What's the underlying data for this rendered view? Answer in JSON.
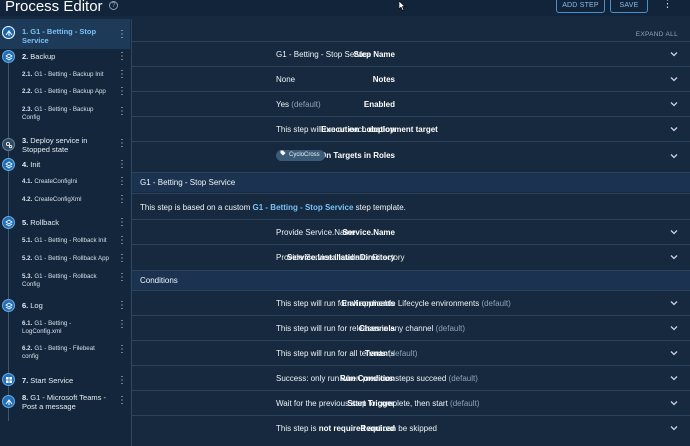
{
  "header": {
    "title": "Process Editor",
    "help_glyph": "?",
    "add_step_label": "ADD STEP",
    "save_label": "SAVE",
    "more_glyph": "⋮"
  },
  "sidebar": {
    "steps": [
      {
        "num": "1.",
        "label": "G1 - Betting - Stop Service",
        "icon": "deploy-icon",
        "selected": true
      },
      {
        "num": "2.",
        "label": "Backup",
        "icon": "layers-icon"
      },
      {
        "num": "2.1.",
        "label": "G1 - Betting - Backup Init",
        "child": true
      },
      {
        "num": "2.2.",
        "label": "G1 - Betting - Backup App",
        "child": true
      },
      {
        "num": "2.3.",
        "label": "G1 - Betting - Backup Config",
        "child": true
      },
      {
        "num": "3.",
        "label": "Deploy service in Stopped state",
        "icon": "gears-icon"
      },
      {
        "num": "4.",
        "label": "Init",
        "icon": "layers-icon"
      },
      {
        "num": "4.1.",
        "label": "CreateConfigIni",
        "child": true
      },
      {
        "num": "4.2.",
        "label": "CreateConfigXml",
        "child": true
      },
      {
        "num": "5.",
        "label": "Rollback",
        "icon": "layers-icon"
      },
      {
        "num": "5.1.",
        "label": "G1 - Betting - Rollback Init",
        "child": true
      },
      {
        "num": "5.2.",
        "label": "G1 - Betting - Rollback App",
        "child": true
      },
      {
        "num": "5.3.",
        "label": "G1 - Betting - Rollback Config",
        "child": true
      },
      {
        "num": "6.",
        "label": "Log",
        "icon": "layers-icon"
      },
      {
        "num": "6.1.",
        "label": "G1 - Betting - LogConfig.xml",
        "child": true
      },
      {
        "num": "6.2.",
        "label": "G1 - Betting - Filebeat config",
        "child": true
      },
      {
        "num": "7.",
        "label": "Start Service",
        "icon": "windows-icon"
      },
      {
        "num": "8.",
        "label": "G1 - Microsoft Teams - Post a message",
        "icon": "deploy-icon"
      }
    ]
  },
  "main": {
    "expand_all": "EXPAND ALL",
    "step_name_label": "Step Name",
    "step_name_value": "G1 - Betting - Stop Service",
    "notes_label": "Notes",
    "notes_value": "None",
    "enabled_label": "Enabled",
    "enabled_value": "Yes",
    "enabled_default": "(default)",
    "exec_label": "Execution Location",
    "exec_value_pre": "This step will run on each",
    "exec_value_bold": "deployment target",
    "roles_label": "On Targets in Roles",
    "roles_tag": "CycloCross",
    "section_template_title": "G1 - Betting - Stop Service",
    "template_info_pre": "This step is based on a custom",
    "template_info_link": "G1 - Betting - Stop Service",
    "template_info_post": "step template.",
    "svc_name_label": "Service.Name",
    "svc_name_placeholder": "Provide Service.Name",
    "svc_dir_label": "Service.InstallationDirectory",
    "svc_dir_placeholder": "Provide Service.InstallationDirectory",
    "conditions_title": "Conditions",
    "conditions": [
      {
        "label": "Environments",
        "value": "This step will run for all applicable Lifecycle environments",
        "suffix": "(default)"
      },
      {
        "label": "Channels",
        "value": "This step will run for releases in any channel",
        "suffix": "(default)"
      },
      {
        "label": "Tenants",
        "value": "This step will run for all tenants",
        "suffix": "(default)"
      },
      {
        "label": "Run Condition",
        "value": "Success: only run when previous steps succeed",
        "suffix": "(default)"
      },
      {
        "label": "Start Trigger",
        "value": "Wait for the previous step to complete, then start",
        "suffix": "(default)"
      }
    ],
    "required_label": "Required",
    "required_pre": "This step is",
    "required_bold": "not required",
    "required_post": "and can be skipped"
  }
}
